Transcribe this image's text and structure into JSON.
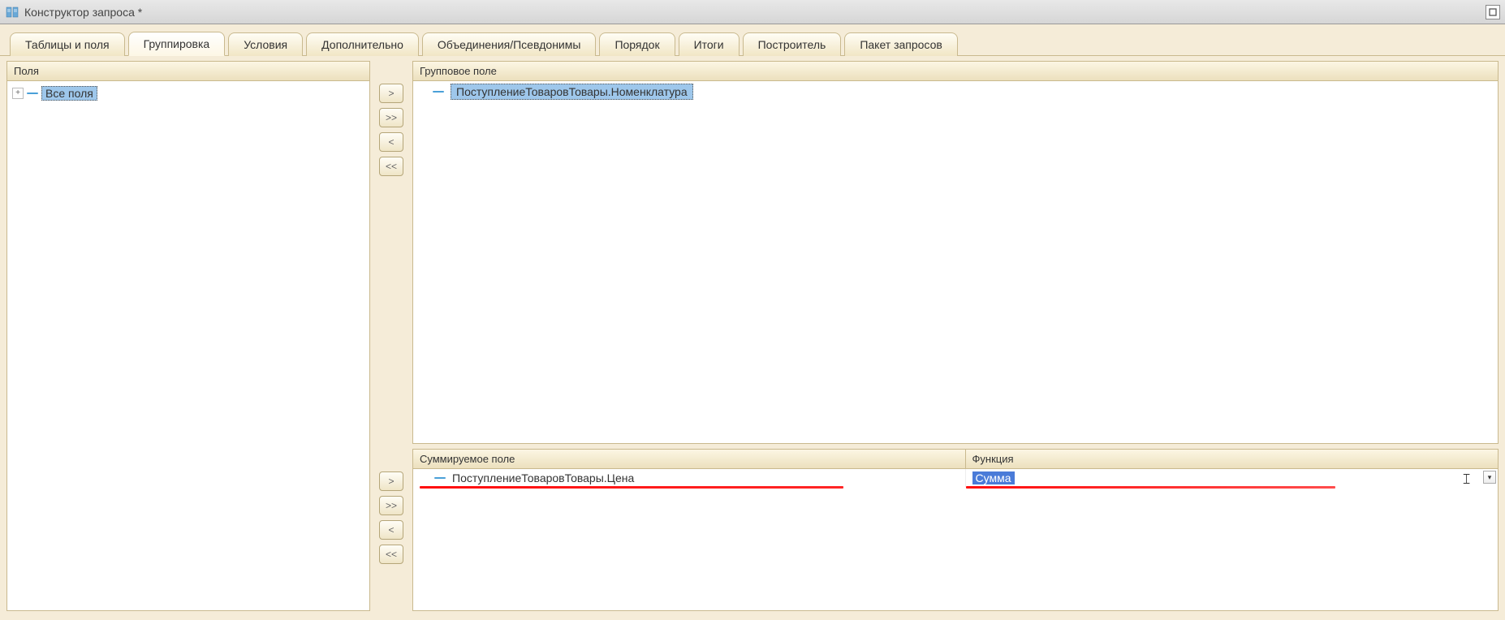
{
  "window": {
    "title": "Конструктор запроса *"
  },
  "tabs": [
    {
      "label": "Таблицы и поля"
    },
    {
      "label": "Группировка"
    },
    {
      "label": "Условия"
    },
    {
      "label": "Дополнительно"
    },
    {
      "label": "Объединения/Псевдонимы"
    },
    {
      "label": "Порядок"
    },
    {
      "label": "Итоги"
    },
    {
      "label": "Построитель"
    },
    {
      "label": "Пакет запросов"
    }
  ],
  "active_tab_index": 1,
  "left_panel": {
    "header": "Поля",
    "root_item": "Все поля"
  },
  "transfer_buttons": {
    "add_one": ">",
    "add_all": ">>",
    "remove_one": "<",
    "remove_all": "<<"
  },
  "group_panel": {
    "header": "Групповое поле",
    "items": [
      "ПоступлениеТоваровТовары.Номенклатура"
    ]
  },
  "sum_panel": {
    "columns": {
      "field": "Суммируемое поле",
      "func": "Функция"
    },
    "rows": [
      {
        "field": "ПоступлениеТоваровТовары.Цена",
        "func": "Сумма"
      }
    ]
  }
}
